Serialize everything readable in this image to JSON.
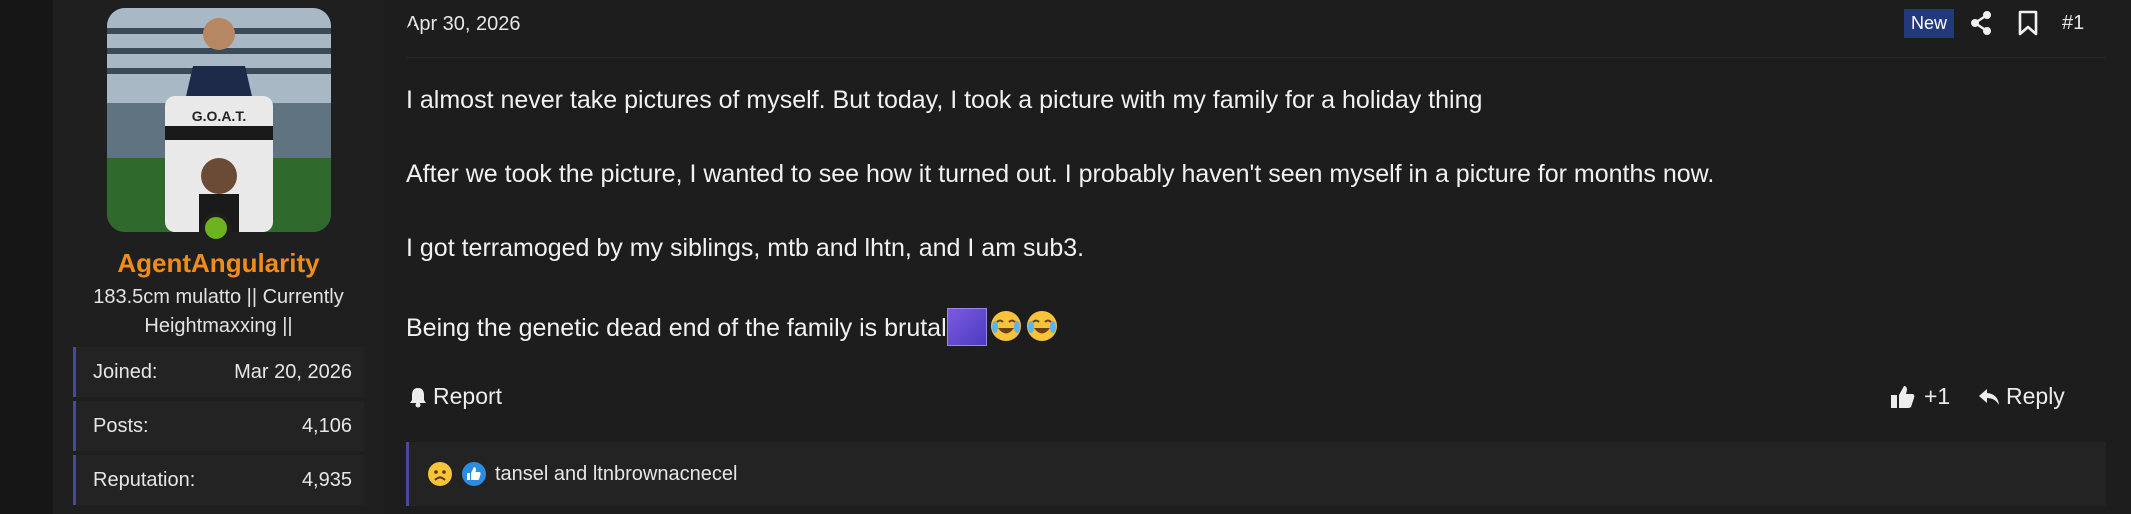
{
  "user": {
    "username": "AgentAngularity",
    "title": "183.5cm mulatto || Currently Heightmaxxing ||",
    "avatar_caption": "G.O.A.T.",
    "online_status": "online-icon",
    "stats": [
      {
        "label": "Joined:",
        "value": "Mar 20, 2026"
      },
      {
        "label": "Posts:",
        "value": "4,106"
      },
      {
        "label": "Reputation:",
        "value": "4,935"
      }
    ]
  },
  "post": {
    "date": "Apr 30, 2026",
    "badge": "New",
    "number": "#1",
    "paragraphs": [
      "I almost never take pictures of myself. But today, I took a picture with my family for a holiday thing",
      "After we took the picture, I wanted to see how it turned out. I probably haven't seen myself in a picture for months now.",
      "I got terramoged by my siblings, mtb and lhtn, and I am sub3.",
      "Being the genetic dead end of the family is brutal"
    ],
    "inline_icons": [
      "inline-image",
      "crying-laughing-emoji",
      "crying-laughing-emoji"
    ]
  },
  "actions": {
    "report_label": "Report",
    "like_count": "+1",
    "reply_label": "Reply"
  },
  "reactions": {
    "icons": [
      "sad-face-icon",
      "thumbs-up-icon"
    ],
    "names": "tansel and ltnbrownacnecel"
  },
  "colors": {
    "username": "#f08c1a",
    "badge_bg": "#223a7c",
    "accent_border": "#4a4a9c",
    "online": "#6db31f"
  }
}
